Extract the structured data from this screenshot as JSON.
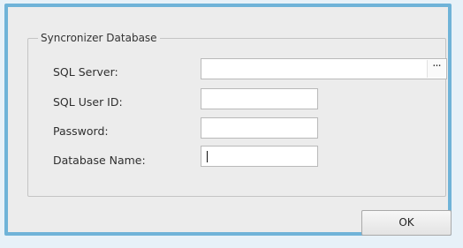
{
  "group": {
    "title": "Syncronizer Database"
  },
  "fields": {
    "sql_server": {
      "label": "SQL Server:",
      "value": "",
      "browse_label": "···"
    },
    "sql_user_id": {
      "label": "SQL User ID:",
      "value": ""
    },
    "password": {
      "label": "Password:",
      "value": ""
    },
    "database_name": {
      "label": "Database Name:",
      "value": ""
    }
  },
  "buttons": {
    "ok_label": "OK"
  },
  "colors": {
    "window_border": "#6fb3d8",
    "dialog_background": "#ececec"
  }
}
